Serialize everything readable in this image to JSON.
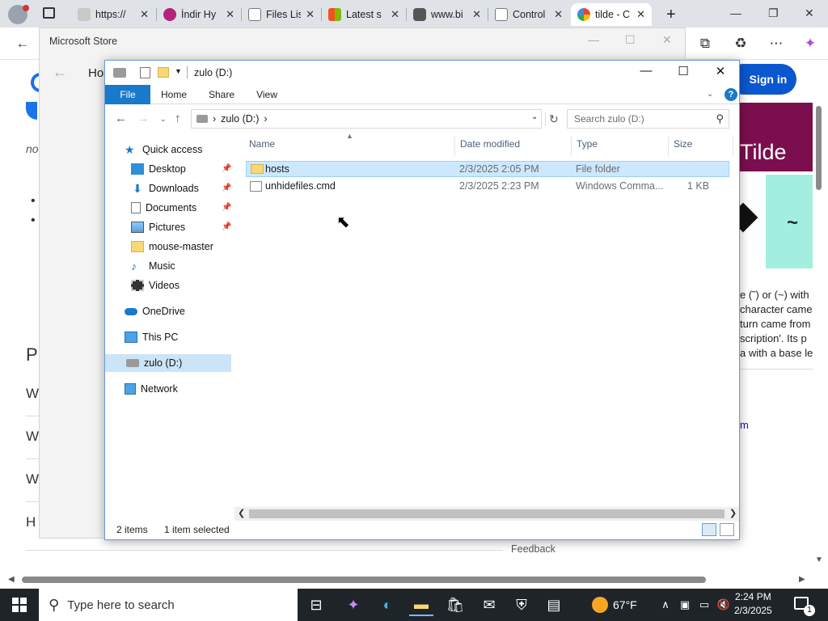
{
  "browser": {
    "tabs": [
      {
        "title": "https://"
      },
      {
        "title": "İndir Hy"
      },
      {
        "title": "Files Lis"
      },
      {
        "title": "Latest s"
      },
      {
        "title": "www.bi"
      },
      {
        "title": "Control"
      },
      {
        "title": "tilde - C",
        "active": true
      }
    ],
    "sign_in": "Sign in",
    "page_left_texts": [
      "Ho",
      "no",
      "P",
      "W",
      "W",
      "W",
      "H"
    ],
    "tilde_image_text": "Tilde",
    "tilde_glyph": "~",
    "side_lines": [
      "e (˜) or (~) with",
      "character came",
      "turn came from",
      "scription'. Its p",
      "a with a base le"
    ],
    "side_link": "m",
    "feedback": "Feedback"
  },
  "store": {
    "title": "Microsoft Store"
  },
  "explorer": {
    "title": "zulo (D:)",
    "ribbon_tabs": [
      "File",
      "Home",
      "Share",
      "View"
    ],
    "address": {
      "location": "zulo (D:)",
      "chevron": "›"
    },
    "search_placeholder": "Search zulo (D:)",
    "nav": [
      {
        "label": "Quick access",
        "icon": "star-icon"
      },
      {
        "label": "Desktop",
        "icon": "desktop-icon",
        "pinned": true
      },
      {
        "label": "Downloads",
        "icon": "download-icon",
        "pinned": true
      },
      {
        "label": "Documents",
        "icon": "document-icon",
        "pinned": true
      },
      {
        "label": "Pictures",
        "icon": "picture-icon",
        "pinned": true
      },
      {
        "label": "mouse-master",
        "icon": "folder-icon"
      },
      {
        "label": "Music",
        "icon": "music-icon"
      },
      {
        "label": "Videos",
        "icon": "video-icon"
      },
      {
        "label": "OneDrive",
        "icon": "cloud-icon"
      },
      {
        "label": "This PC",
        "icon": "pc-icon"
      },
      {
        "label": "zulo (D:)",
        "icon": "drive-icon",
        "selected": true
      },
      {
        "label": "Network",
        "icon": "network-icon"
      }
    ],
    "columns": [
      "Name",
      "Date modified",
      "Type",
      "Size"
    ],
    "files": [
      {
        "name": "hosts",
        "date": "2/3/2025 2:05 PM",
        "type": "File folder",
        "size": "",
        "selected": true,
        "icon": "folder-icon"
      },
      {
        "name": "unhidefiles.cmd",
        "date": "2/3/2025 2:23 PM",
        "type": "Windows Comma...",
        "size": "1 KB",
        "selected": false,
        "icon": "script-icon"
      }
    ],
    "status": {
      "items": "2 items",
      "selection": "1 item selected"
    }
  },
  "taskbar": {
    "search_placeholder": "Type here to search",
    "weather": "67°F",
    "time": "2:24 PM",
    "date": "2/3/2025",
    "notification_count": "1"
  },
  "colors": {
    "accent": "#1979ca",
    "selection": "#cce8ff",
    "taskbar": "#1f2429",
    "signin": "#0b57d0",
    "tilde_bg": "#7a0e4e"
  }
}
